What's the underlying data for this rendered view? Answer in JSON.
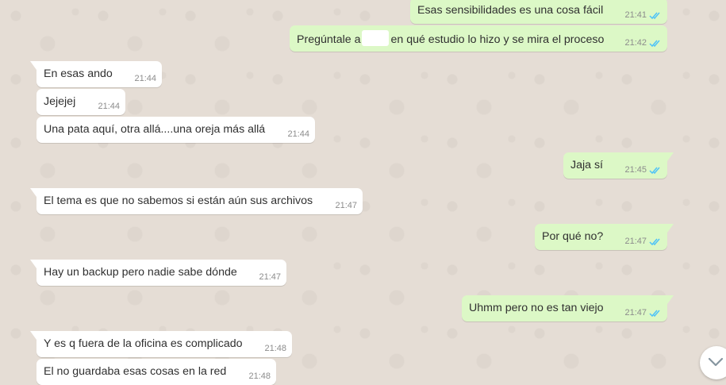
{
  "chat": {
    "messages": [
      {
        "direction": "out",
        "text": "Esas sensibilidades es una cosa fácil",
        "time": "21:41",
        "read": true
      },
      {
        "direction": "out",
        "text_before": "Pregúntale a",
        "text_after": "en qué estudio lo hizo y se mira el proceso",
        "time": "21:42",
        "read": true
      },
      {
        "direction": "in",
        "text": "En esas ando",
        "time": "21:44"
      },
      {
        "direction": "in",
        "text": "Jejejej",
        "time": "21:44"
      },
      {
        "direction": "in",
        "text": "Una pata aquí, otra allá....una oreja más allá",
        "time": "21:44"
      },
      {
        "direction": "out",
        "text": "Jaja sí",
        "time": "21:45",
        "read": true
      },
      {
        "direction": "in",
        "text": "El tema es que no sabemos si están aún sus archivos",
        "time": "21:47"
      },
      {
        "direction": "out",
        "text": "Por qué no?",
        "time": "21:47",
        "read": true
      },
      {
        "direction": "in",
        "text": "Hay un backup pero nadie sabe dónde",
        "time": "21:47"
      },
      {
        "direction": "out",
        "text": "Uhmm pero no es tan viejo",
        "time": "21:47",
        "read": true
      },
      {
        "direction": "in",
        "text": "Y es q fuera de la oficina es complicado",
        "time": "21:48"
      },
      {
        "direction": "in",
        "text": "El no guardaba esas cosas en la red",
        "time": "21:48"
      }
    ]
  },
  "icons": {
    "read_receipt": "double-check-icon",
    "scroll_down": "chevron-down-icon"
  },
  "colors": {
    "wallpaper": "#e5ddd5",
    "incoming_bubble": "#ffffff",
    "outgoing_bubble": "#dcf8c6",
    "read_tick": "#4fc3f7",
    "time_text": "#8c8c8c"
  }
}
